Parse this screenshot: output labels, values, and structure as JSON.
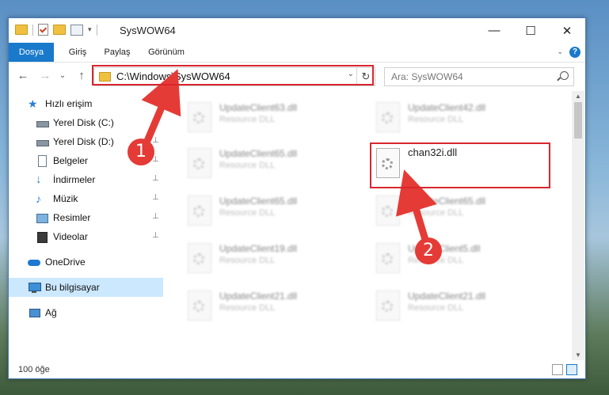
{
  "window": {
    "title": "SysWOW64",
    "minimize_glyph": "—",
    "maximize_glyph": "☐",
    "close_glyph": "✕"
  },
  "ribbon": {
    "tabs": [
      "Dosya",
      "Giriş",
      "Paylaş",
      "Görünüm"
    ],
    "help": "?"
  },
  "nav": {
    "back": "←",
    "forward": "→",
    "recent": "⌄",
    "up": "↑",
    "address": "C:\\Windows\\SysWOW64",
    "address_dropdown": "⌄",
    "refresh": "↻",
    "search_placeholder": "Ara: SysWOW64"
  },
  "sidebar": {
    "items": [
      {
        "label": "Hızlı erişim",
        "icon": "star-icon"
      },
      {
        "label": "Yerel Disk (C:)",
        "icon": "drive-icon",
        "pinned": true
      },
      {
        "label": "Yerel Disk (D:)",
        "icon": "drive-icon",
        "pinned": true
      },
      {
        "label": "Belgeler",
        "icon": "document-icon",
        "pinned": true
      },
      {
        "label": "İndirmeler",
        "icon": "download-icon",
        "pinned": true
      },
      {
        "label": "Müzik",
        "icon": "music-icon",
        "pinned": true
      },
      {
        "label": "Resimler",
        "icon": "pictures-icon",
        "pinned": true
      },
      {
        "label": "Videolar",
        "icon": "video-icon",
        "pinned": true
      },
      {
        "label": "OneDrive",
        "icon": "cloud-icon"
      },
      {
        "label": "Bu bilgisayar",
        "icon": "computer-icon",
        "selected": true
      },
      {
        "label": "Ağ",
        "icon": "network-icon"
      }
    ]
  },
  "files": [
    {
      "name": "UpdateClient63.dll",
      "desc": "Resource DLL"
    },
    {
      "name": "UpdateClient42.dll",
      "desc": "Resource DLL"
    },
    {
      "name": "UpdateClient65.dll",
      "desc": "Resource DLL"
    },
    {
      "name": "chan32i.dll",
      "desc": ""
    },
    {
      "name": "UpdateClient65.dll",
      "desc": "Resource DLL"
    },
    {
      "name": "UpdateClient65.dll",
      "desc": "Resource DLL"
    },
    {
      "name": "UpdateClient19.dll",
      "desc": "Resource DLL"
    },
    {
      "name": "UpdateClient5.dll",
      "desc": "Resource DLL"
    },
    {
      "name": "UpdateClient21.dll",
      "desc": "Resource DLL"
    },
    {
      "name": "UpdateClient21.dll",
      "desc": "Resource DLL"
    }
  ],
  "status": {
    "count": "100 öğe"
  },
  "annotations": {
    "step1": "1",
    "step2": "2",
    "color": "#e53b36"
  }
}
